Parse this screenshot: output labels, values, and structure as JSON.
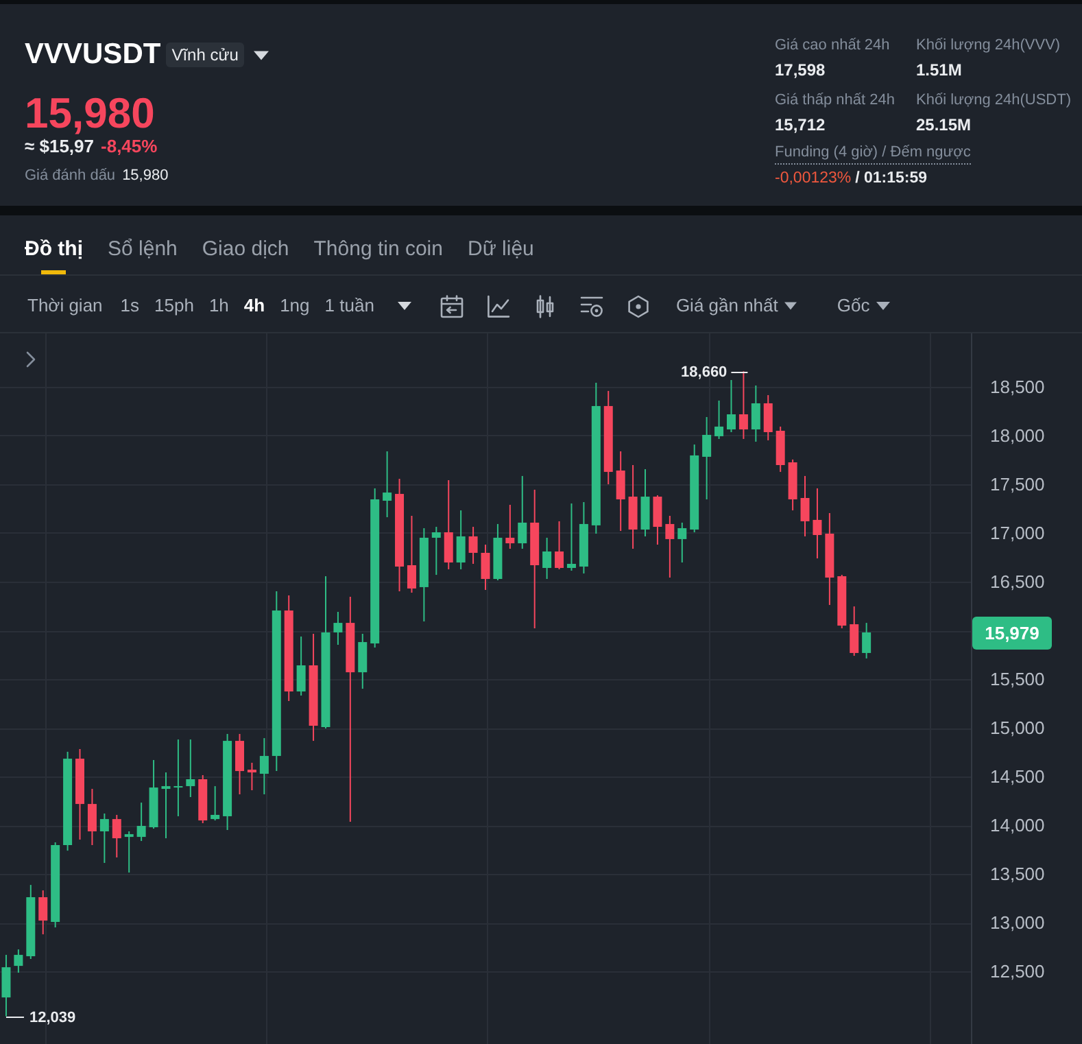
{
  "header": {
    "symbol": "VVVUSDT",
    "contract_badge": "Vĩnh cửu",
    "last_price": "15,980",
    "usd_price": "≈ $15,97",
    "change": "-8,45%",
    "mark_price_label": "Giá đánh dấu",
    "mark_price": "15,980",
    "stats": [
      {
        "label": "Giá cao nhất 24h",
        "value": "17,598"
      },
      {
        "label": "Khối lượng 24h(VVV)",
        "value": "1.51M"
      },
      {
        "label": "Giá thấp nhất 24h",
        "value": "15,712"
      },
      {
        "label": "Khối lượng 24h(USDT)",
        "value": "25.15M"
      }
    ],
    "funding": {
      "label": "Funding (4 giờ) / Đếm ngược",
      "rate": "-0,00123%",
      "countdown": "/ 01:15:59"
    }
  },
  "tabs": [
    {
      "label": "Đồ thị",
      "selected": true
    },
    {
      "label": "Sổ lệnh",
      "selected": false
    },
    {
      "label": "Giao dịch",
      "selected": false
    },
    {
      "label": "Thông tin coin",
      "selected": false
    },
    {
      "label": "Dữ liệu",
      "selected": false
    }
  ],
  "toolbar": {
    "label": "Thời gian",
    "intervals": [
      {
        "label": "1s",
        "selected": false
      },
      {
        "label": "15ph",
        "selected": false
      },
      {
        "label": "1h",
        "selected": false
      },
      {
        "label": "4h",
        "selected": true
      },
      {
        "label": "1ng",
        "selected": false
      },
      {
        "label": "1 tuần",
        "selected": false
      }
    ],
    "price_source": "Giá gần nhất",
    "scale": "Gốc"
  },
  "chart": {
    "chart_data": {
      "type": "candlestick",
      "categories": [
        null,
        null,
        null,
        null,
        null,
        null,
        null,
        null,
        null,
        null,
        null,
        null,
        null,
        null,
        null,
        null,
        null,
        null,
        null,
        null,
        null,
        null,
        null,
        null,
        null,
        null,
        null,
        null,
        null,
        null,
        null,
        null,
        null,
        null,
        null,
        null,
        null,
        null,
        null,
        null,
        null,
        null,
        null,
        null,
        null,
        null,
        null,
        null,
        null,
        null,
        null,
        null,
        null,
        null,
        null,
        null,
        null,
        null,
        null,
        null,
        null,
        null,
        null,
        null,
        null,
        null,
        null,
        null,
        null,
        null,
        null,
        null,
        null,
        null,
        null,
        null,
        null,
        null,
        null
      ],
      "ohlc": [
        [
          12232,
          12669,
          12039,
          12542
        ],
        [
          12556,
          12725,
          12486,
          12669
        ],
        [
          12655,
          13387,
          12627,
          13261
        ],
        [
          13261,
          13331,
          12880,
          13021
        ],
        [
          13007,
          13824,
          12951,
          13796
        ],
        [
          13796,
          14754,
          13739,
          14683
        ],
        [
          14683,
          14782,
          13852,
          14218
        ],
        [
          14218,
          14373,
          13796,
          13937
        ],
        [
          13937,
          14120,
          13613,
          14063
        ],
        [
          14063,
          14106,
          13669,
          13866
        ],
        [
          13880,
          13937,
          13514,
          13908
        ],
        [
          13880,
          14232,
          13838,
          13993
        ],
        [
          13979,
          14669,
          13965,
          14387
        ],
        [
          14373,
          14542,
          13866,
          14401
        ],
        [
          14387,
          14880,
          14092,
          14401
        ],
        [
          14401,
          14880,
          14289,
          14472
        ],
        [
          14472,
          14514,
          14021,
          14049
        ],
        [
          14063,
          14401,
          14049,
          14106
        ],
        [
          14092,
          14937,
          13951,
          14866
        ],
        [
          14866,
          14937,
          14317,
          14556
        ],
        [
          14570,
          14641,
          14359,
          14542
        ],
        [
          14528,
          14894,
          14317,
          14711
        ],
        [
          14711,
          16401,
          14556,
          16204
        ],
        [
          16204,
          16359,
          15275,
          15373
        ],
        [
          15373,
          15937,
          15331,
          15641
        ],
        [
          15641,
          15965,
          14866,
          15021
        ],
        [
          15007,
          16556,
          14993,
          15979
        ],
        [
          15979,
          16190,
          15852,
          16077
        ],
        [
          16077,
          16345,
          14035,
          15570
        ],
        [
          15570,
          15965,
          15401,
          15880
        ],
        [
          15866,
          17458,
          15824,
          17345
        ],
        [
          17331,
          17838,
          17162,
          17415
        ],
        [
          17401,
          17556,
          16401,
          16655
        ],
        [
          16669,
          17176,
          16387,
          16430
        ],
        [
          16444,
          17049,
          16092,
          16951
        ],
        [
          16951,
          17063,
          16570,
          17007
        ],
        [
          17007,
          17542,
          16627,
          16697
        ],
        [
          16697,
          17232,
          16627,
          16965
        ],
        [
          16965,
          17063,
          16683,
          16796
        ],
        [
          16796,
          16880,
          16415,
          16528
        ],
        [
          16528,
          17092,
          16514,
          16951
        ],
        [
          16951,
          17289,
          16838,
          16894
        ],
        [
          16894,
          17585,
          16838,
          17106
        ],
        [
          17106,
          17444,
          16021,
          16669
        ],
        [
          16641,
          16951,
          16528,
          16810
        ],
        [
          16810,
          17120,
          16627,
          16641
        ],
        [
          16641,
          17303,
          16613,
          16683
        ],
        [
          16655,
          17317,
          16584,
          17092
        ],
        [
          17078,
          18542,
          16993,
          18303
        ],
        [
          18303,
          18458,
          17500,
          17627
        ],
        [
          17641,
          17838,
          17021,
          17345
        ],
        [
          17373,
          17697,
          16838,
          17035
        ],
        [
          17035,
          17655,
          16965,
          17373
        ],
        [
          17373,
          17387,
          16880,
          17063
        ],
        [
          17092,
          17176,
          16542,
          16937
        ],
        [
          16937,
          17106,
          16697,
          17049
        ],
        [
          17035,
          17908,
          17007,
          17796
        ],
        [
          17782,
          18190,
          17345,
          18007
        ],
        [
          17993,
          18359,
          17965,
          18092
        ],
        [
          18063,
          18570,
          18035,
          18218
        ],
        [
          18218,
          18660,
          17965,
          18063
        ],
        [
          18063,
          18514,
          17937,
          18331
        ],
        [
          18331,
          18415,
          17951,
          18035
        ],
        [
          18049,
          18092,
          17627,
          17697
        ],
        [
          17725,
          17754,
          17232,
          17345
        ],
        [
          17359,
          17585,
          16965,
          17120
        ],
        [
          17134,
          17458,
          16739,
          16979
        ],
        [
          16993,
          17204,
          16261,
          16542
        ],
        [
          16556,
          16570,
          16021,
          16049
        ],
        [
          16063,
          16246,
          15739,
          15768
        ],
        [
          15768,
          16077,
          15712,
          15979
        ],
        null,
        null,
        null,
        null,
        null,
        null,
        null,
        null
      ],
      "ylim": [
        11754,
        19049
      ],
      "grid": true,
      "yticks": [
        {
          "value": 18500,
          "label": "18,500"
        },
        {
          "value": 18000,
          "label": "18,000"
        },
        {
          "value": 17500,
          "label": "17,500"
        },
        {
          "value": 17000,
          "label": "17,000"
        },
        {
          "value": 16500,
          "label": "16,500"
        },
        {
          "value": 15500,
          "label": "15,500"
        },
        {
          "value": 15000,
          "label": "15,000"
        },
        {
          "value": 14500,
          "label": "14,500"
        },
        {
          "value": 14000,
          "label": "14,000"
        },
        {
          "value": 13500,
          "label": "13,500"
        },
        {
          "value": 13000,
          "label": "13,000"
        },
        {
          "value": 12500,
          "label": "12,500"
        }
      ],
      "annotations": [
        "18,660",
        "12,039",
        "15,979"
      ]
    }
  }
}
